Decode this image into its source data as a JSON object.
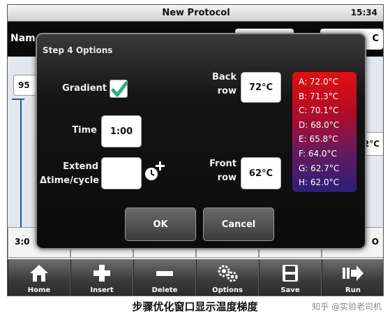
{
  "titlebar": {
    "title": "New Protocol",
    "clock": "15:34"
  },
  "namebar": {
    "label_partial": "Nam",
    "right_value_partial": "C"
  },
  "background_steps": {
    "left_temp_partial": "95",
    "right_temp_partial": "2°C",
    "bottom_left_partial": "3:0",
    "bottom_right_partial": "O"
  },
  "dialog": {
    "title": "Step 4 Options",
    "gradient_label": "Gradient",
    "gradient_checked": true,
    "back_row_label_line1": "Back",
    "back_row_label_line2": "row",
    "back_row_value": "72°C",
    "time_label": "Time",
    "time_value": "1:00",
    "extend_label_line1": "Extend",
    "extend_label_line2": "Δtime/cycle",
    "extend_value": "",
    "front_row_label_line1": "Front",
    "front_row_label_line2": "row",
    "front_row_value": "62°C",
    "gradient_rows": [
      "A: 72.0°C",
      "B: 71.3°C",
      "C: 70.1°C",
      "D: 68.0°C",
      "E: 65.8°C",
      "F: 64.0°C",
      "G: 62.7°C",
      "H: 62.0°C"
    ],
    "ok_label": "OK",
    "cancel_label": "Cancel"
  },
  "toolbar": {
    "home": "Home",
    "insert": "Insert",
    "delete": "Delete",
    "options": "Options",
    "save": "Save",
    "run": "Run"
  },
  "caption": "步骤优化窗口显示温度梯度",
  "watermark": "知乎 @实验老司机",
  "colors": {
    "check_green": "#2bb07a",
    "gradient_top": "#e01010",
    "gradient_bottom": "#2a1f7a",
    "graph_blue": "#1b56a8"
  }
}
